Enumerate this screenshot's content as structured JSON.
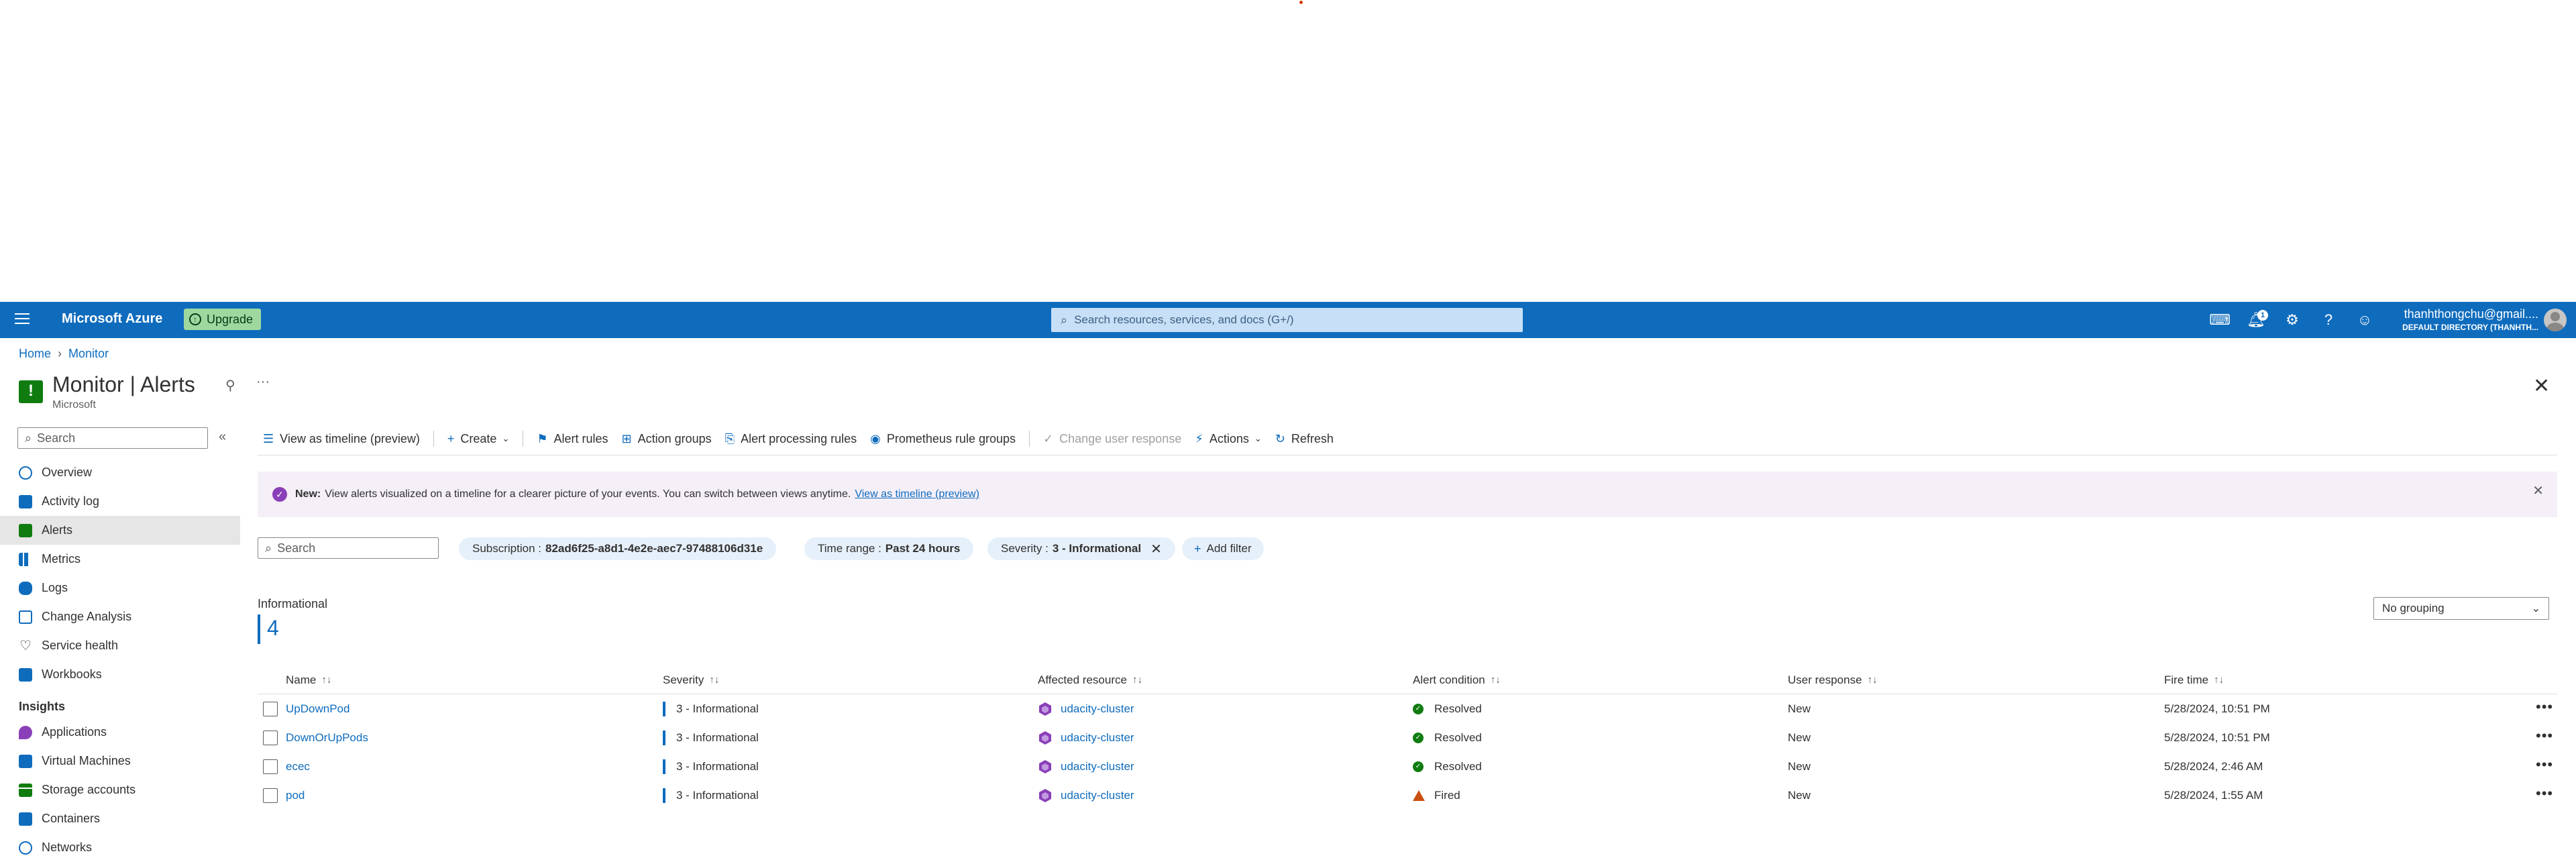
{
  "topbar": {
    "brand": "Microsoft Azure",
    "upgrade_label": "Upgrade",
    "search_placeholder": "Search resources, services, and docs (G+/)",
    "notification_count": "1",
    "user_email": "thanhthongchu@gmail....",
    "directory": "DEFAULT DIRECTORY (THANHTH..."
  },
  "breadcrumb": {
    "home": "Home",
    "monitor": "Monitor"
  },
  "page": {
    "title": "Monitor | Alerts",
    "subtitle": "Microsoft"
  },
  "sidebar": {
    "search_placeholder": "Search",
    "items": [
      {
        "label": "Overview",
        "icon": "overview-icon",
        "color": "#0f6cbd"
      },
      {
        "label": "Activity log",
        "icon": "activity-log-icon",
        "color": "#0f6cbd"
      },
      {
        "label": "Alerts",
        "icon": "alerts-icon",
        "color": "#107c10"
      },
      {
        "label": "Metrics",
        "icon": "metrics-icon",
        "color": "#0f6cbd"
      },
      {
        "label": "Logs",
        "icon": "logs-icon",
        "color": "#0f6cbd"
      },
      {
        "label": "Change Analysis",
        "icon": "change-analysis-icon",
        "color": "#0f6cbd"
      },
      {
        "label": "Service health",
        "icon": "heart-icon",
        "color": "#323130"
      },
      {
        "label": "Workbooks",
        "icon": "workbooks-icon",
        "color": "#0f6cbd"
      }
    ],
    "insights_heading": "Insights",
    "insights": [
      {
        "label": "Applications",
        "icon": "applications-icon",
        "color": "#8a3fb8"
      },
      {
        "label": "Virtual Machines",
        "icon": "vm-icon",
        "color": "#0f6cbd"
      },
      {
        "label": "Storage accounts",
        "icon": "storage-icon",
        "color": "#107c10"
      },
      {
        "label": "Containers",
        "icon": "containers-icon",
        "color": "#0f6cbd"
      },
      {
        "label": "Networks",
        "icon": "networks-icon",
        "color": "#0f6cbd"
      }
    ]
  },
  "commands": {
    "timeline": "View as timeline (preview)",
    "create": "Create",
    "alert_rules": "Alert rules",
    "action_groups": "Action groups",
    "processing_rules": "Alert processing rules",
    "prometheus": "Prometheus rule groups",
    "change_response": "Change user response",
    "actions": "Actions",
    "refresh": "Refresh"
  },
  "banner": {
    "new_label": "New:",
    "text": "View alerts visualized on a timeline for a clearer picture of your events. You can switch between views anytime.",
    "link": "View as timeline (preview)"
  },
  "filters": {
    "search_placeholder": "Search",
    "subscription_label": "Subscription :",
    "subscription_value": "82ad6f25-a8d1-4e2e-aec7-97488106d31e",
    "time_label": "Time range :",
    "time_value": "Past 24 hours",
    "severity_label": "Severity :",
    "severity_value": "3 - Informational",
    "add_filter": "Add filter"
  },
  "summary": {
    "label": "Informational",
    "count": "4",
    "grouping": "No grouping"
  },
  "table": {
    "headers": {
      "name": "Name",
      "severity": "Severity",
      "resource": "Affected resource",
      "condition": "Alert condition",
      "response": "User response",
      "time": "Fire time"
    },
    "rows": [
      {
        "name": "UpDownPod",
        "severity": "3 - Informational",
        "resource": "udacity-cluster",
        "condition": "Resolved",
        "response": "New",
        "time": "5/28/2024, 10:51 PM"
      },
      {
        "name": "DownOrUpPods",
        "severity": "3 - Informational",
        "resource": "udacity-cluster",
        "condition": "Resolved",
        "response": "New",
        "time": "5/28/2024, 10:51 PM"
      },
      {
        "name": "ecec",
        "severity": "3 - Informational",
        "resource": "udacity-cluster",
        "condition": "Resolved",
        "response": "New",
        "time": "5/28/2024, 2:46 AM"
      },
      {
        "name": "pod",
        "severity": "3 - Informational",
        "resource": "udacity-cluster",
        "condition": "Fired",
        "response": "New",
        "time": "5/28/2024, 1:55 AM"
      }
    ]
  }
}
